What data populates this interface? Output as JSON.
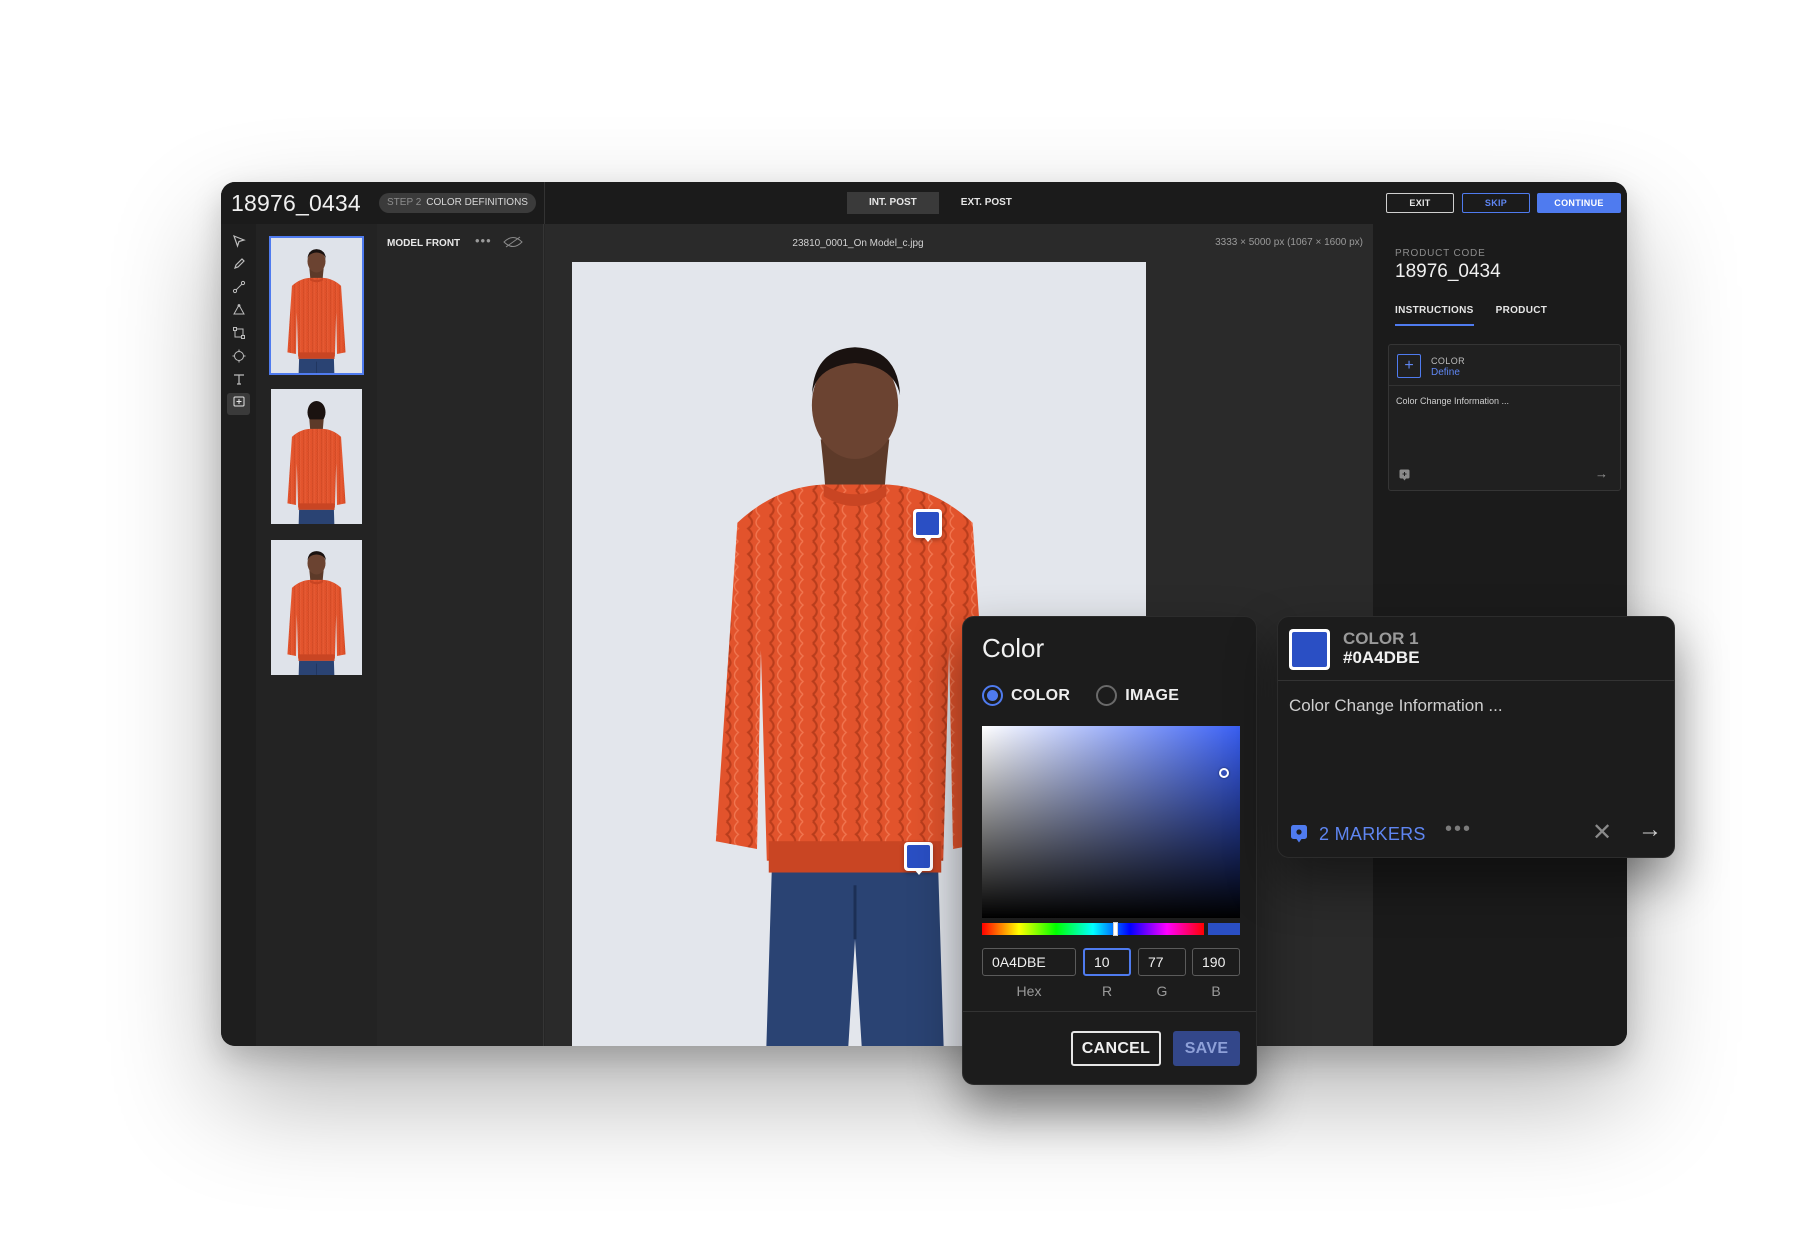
{
  "header": {
    "doc_title": "18976_0434",
    "step_number": "STEP 2",
    "step_label": "COLOR DEFINITIONS",
    "view_tabs": [
      "INT. POST",
      "EXT. POST"
    ],
    "exit_label": "EXIT",
    "skip_label": "SKIP",
    "continue_label": "CONTINUE"
  },
  "tools": [
    "select-arrow-icon",
    "pen-icon",
    "path-icon",
    "vertex-icon",
    "transform-icon",
    "target-icon",
    "text-icon",
    "marker-add-icon"
  ],
  "thumbnails": [
    {
      "view": "front",
      "selected": true
    },
    {
      "view": "back",
      "selected": false
    },
    {
      "view": "front",
      "selected": false
    }
  ],
  "layers": {
    "title": "MODEL FRONT",
    "dots": "•••"
  },
  "canvas": {
    "file_name": "23810_0001_On Model_c.jpg",
    "dimensions": "3333 × 5000 px (1067 × 1600 px)"
  },
  "right_panel": {
    "product_code_label": "PRODUCT CODE",
    "product_code": "18976_0434",
    "tabs": [
      "INSTRUCTIONS",
      "PRODUCT"
    ],
    "card": {
      "add_glyph": "+",
      "label": "COLOR",
      "define": "Define",
      "text": "Color Change Information ...",
      "arrow": "→"
    }
  },
  "color_dialog": {
    "title": "Color",
    "option_color": "COLOR",
    "option_image": "IMAGE",
    "selected_option": "COLOR",
    "hex": "0A4DBE",
    "r": "10",
    "g": "77",
    "b": "190",
    "labels": {
      "hex": "Hex",
      "r": "R",
      "g": "G",
      "b": "B"
    },
    "cancel_label": "CANCEL",
    "save_label": "SAVE"
  },
  "info_card": {
    "name": "COLOR 1",
    "hex": "#0A4DBE",
    "text": "Color Change Information ...",
    "markers": "2 MARKERS",
    "dots": "•••",
    "close": "✕",
    "arrow": "→"
  },
  "colors": {
    "accent": "#4f7bef",
    "swatch": "#2a4fc4",
    "sweater": "#e2532c",
    "jeans": "#2a4373"
  }
}
